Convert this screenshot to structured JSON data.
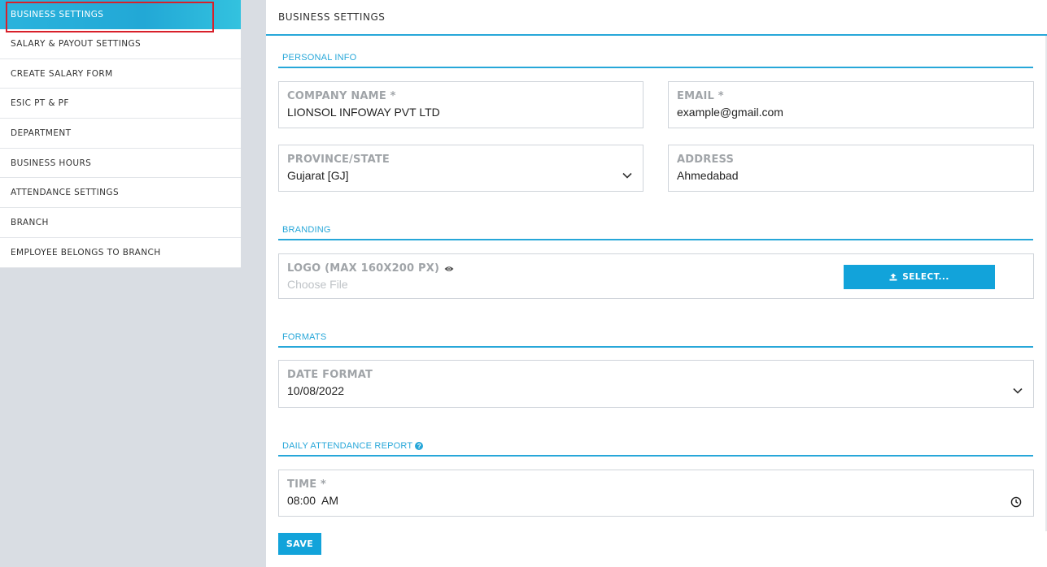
{
  "sidebar": {
    "items": [
      {
        "label": "BUSINESS SETTINGS",
        "active": true
      },
      {
        "label": "SALARY & PAYOUT SETTINGS"
      },
      {
        "label": "CREATE SALARY FORM"
      },
      {
        "label": "ESIC PT & PF"
      },
      {
        "label": "DEPARTMENT"
      },
      {
        "label": "BUSINESS HOURS"
      },
      {
        "label": "ATTENDANCE SETTINGS"
      },
      {
        "label": "BRANCH"
      },
      {
        "label": "EMPLOYEE BELONGS TO BRANCH"
      }
    ]
  },
  "page": {
    "title": "BUSINESS SETTINGS"
  },
  "personal_info": {
    "heading": "PERSONAL INFO",
    "company_name": {
      "label": "COMPANY NAME *",
      "value": "LIONSOL INFOWAY PVT LTD"
    },
    "email": {
      "label": "EMAIL *",
      "value": "example@gmail.com"
    },
    "province": {
      "label": "PROVINCE/STATE",
      "value": "Gujarat [GJ]"
    },
    "address": {
      "label": "ADDRESS",
      "value": "Ahmedabad"
    }
  },
  "branding": {
    "heading": "BRANDING",
    "logo": {
      "label": "LOGO (MAX 160X200 PX)",
      "placeholder": "Choose File"
    },
    "select_label": "SELECT..."
  },
  "formats": {
    "heading": "FORMATS",
    "date_format": {
      "label": "DATE FORMAT",
      "value": "10/08/2022"
    }
  },
  "daily_report": {
    "heading": "DAILY ATTENDANCE REPORT",
    "time": {
      "label": "TIME *",
      "value": "08:00  AM"
    }
  },
  "save_label": "SAVE",
  "colors": {
    "accent": "#27a7d9",
    "button": "#12a3da",
    "highlight_outline": "#d8202a"
  },
  "icons": [
    "chevron-down-icon",
    "eye-icon",
    "upload-icon",
    "help-icon",
    "clock-icon"
  ]
}
